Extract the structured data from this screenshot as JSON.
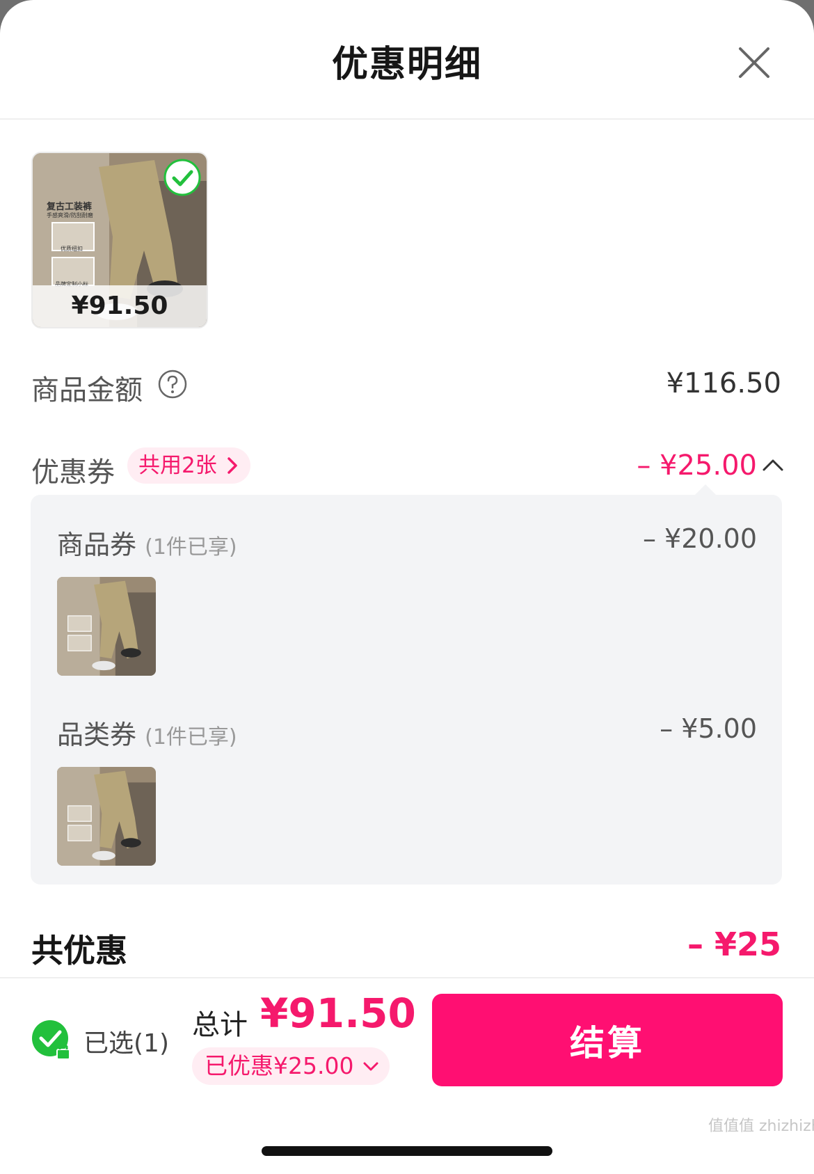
{
  "header": {
    "title": "优惠明细"
  },
  "product": {
    "card_price": "¥91.50",
    "image_text": {
      "line1": "复古工装裤",
      "line2": "手感爽滑/防刮耐磨",
      "line3": "优质纽扣",
      "line4": "品牌定制小标"
    }
  },
  "goods_amount": {
    "label": "商品金额",
    "value": "¥116.50"
  },
  "coupon": {
    "label": "优惠券",
    "chip": "共用2张",
    "value": "– ¥25.00"
  },
  "coupon_details": [
    {
      "label": "商品券",
      "note": "(1件已享)",
      "value": "– ¥20.00"
    },
    {
      "label": "品类券",
      "note": "(1件已享)",
      "value": "– ¥5.00"
    }
  ],
  "total_discount": {
    "label": "共优惠",
    "value": "– ¥25"
  },
  "footer": {
    "selected": "已选(1)",
    "total_label": "总计",
    "total_value": "¥91.50",
    "saved": "已优惠¥25.00",
    "checkout": "结算"
  },
  "watermark": "值值值 zhizhizhi.com",
  "colors": {
    "accent": "#ff0f72",
    "accent_text": "#f5196c",
    "check_green": "#22c03c"
  }
}
